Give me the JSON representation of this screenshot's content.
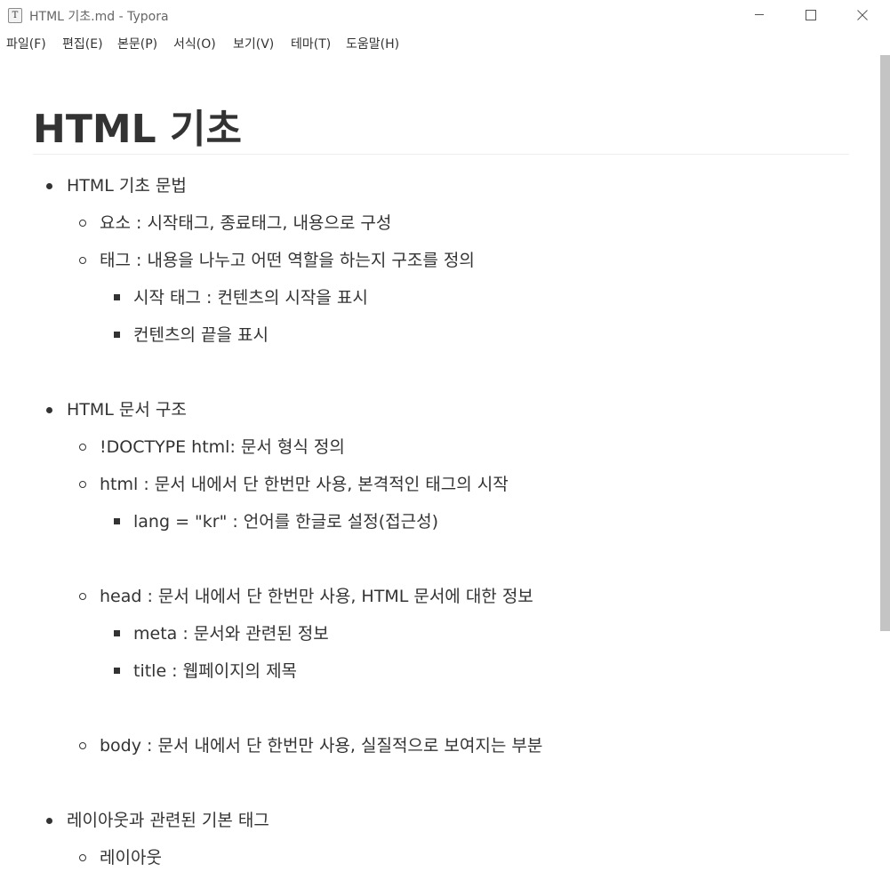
{
  "window": {
    "app_icon_letter": "T",
    "title": "HTML 기초.md - Typora"
  },
  "menu": {
    "items": [
      "파일(F)",
      "편집(E)",
      "본문(P)",
      "서식(O)",
      "보기(V)",
      "테마(T)",
      "도움말(H)"
    ]
  },
  "document": {
    "title": "HTML 기초",
    "items": [
      "HTML 기초 문법",
      "요소 :  시작태그, 종료태그, 내용으로 구성",
      "태그 : 내용을 나누고 어떤 역할을 하는지 구조를 정의",
      "시작 태그 : 컨텐츠의 시작을 표시",
      "컨텐츠의 끝을 표시",
      "HTML 문서 구조",
      "!DOCTYPE html: 문서 형식 정의",
      "html : 문서 내에서 단 한번만 사용, 본격적인 태그의 시작",
      "lang = \"kr\" : 언어를 한글로 설정(접근성)",
      "head : 문서 내에서 단 한번만 사용, HTML 문서에 대한 정보",
      "meta : 문서와 관련된 정보",
      "title : 웹페이지의 제목",
      "body : 문서 내에서 단 한번만 사용, 실질적으로 보여지는 부분",
      "레이아웃과 관련된 기본 태그",
      "레이아웃"
    ]
  }
}
